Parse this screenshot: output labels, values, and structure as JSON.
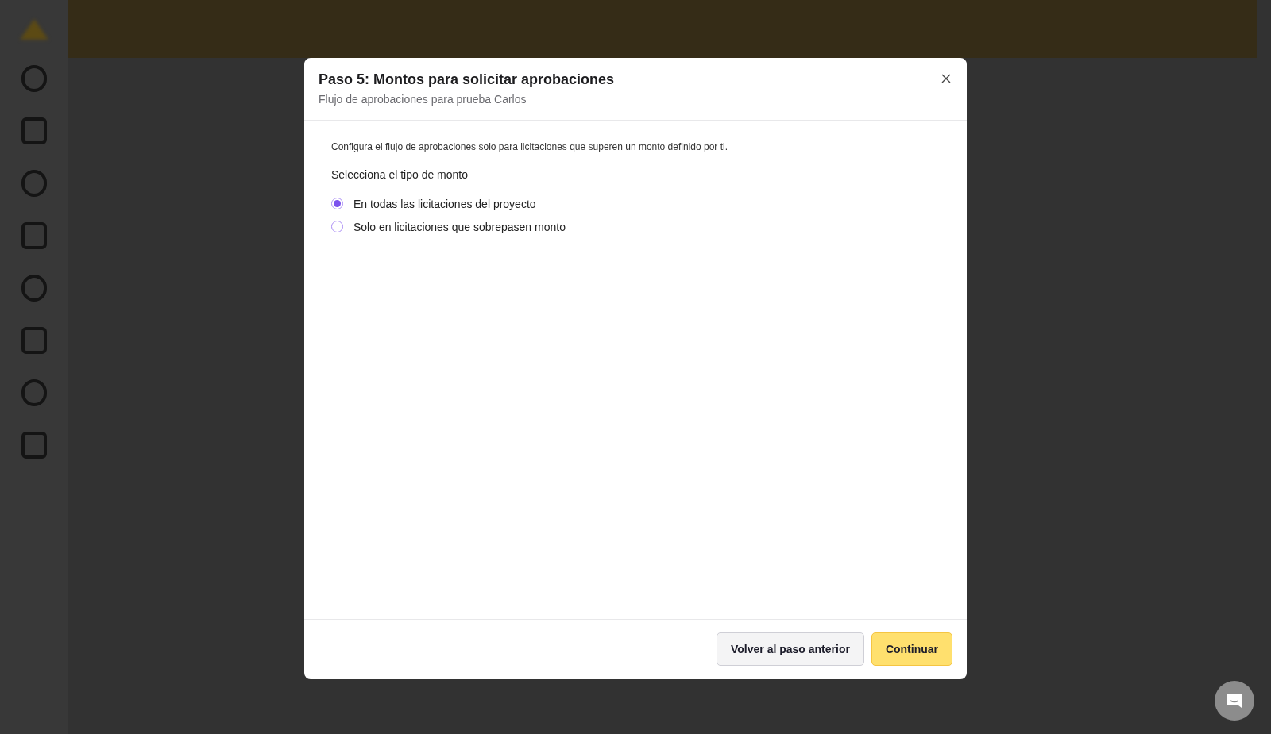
{
  "dialog": {
    "title": "Paso 5: Montos para solicitar aprobaciones",
    "subtitle": "Flujo de aprobaciones para prueba Carlos",
    "description": "Configura el flujo de aprobaciones solo para licitaciones que superen un monto definido por ti.",
    "question": "Selecciona el tipo de monto",
    "options": [
      {
        "label": "En todas las licitaciones del proyecto",
        "selected": true
      },
      {
        "label": "Solo en licitaciones que sobrepasen monto",
        "selected": false
      }
    ],
    "buttons": [
      {
        "label": "Volver al paso anterior",
        "kind": "secondary"
      },
      {
        "label": "Continuar",
        "kind": "primary"
      }
    ]
  }
}
